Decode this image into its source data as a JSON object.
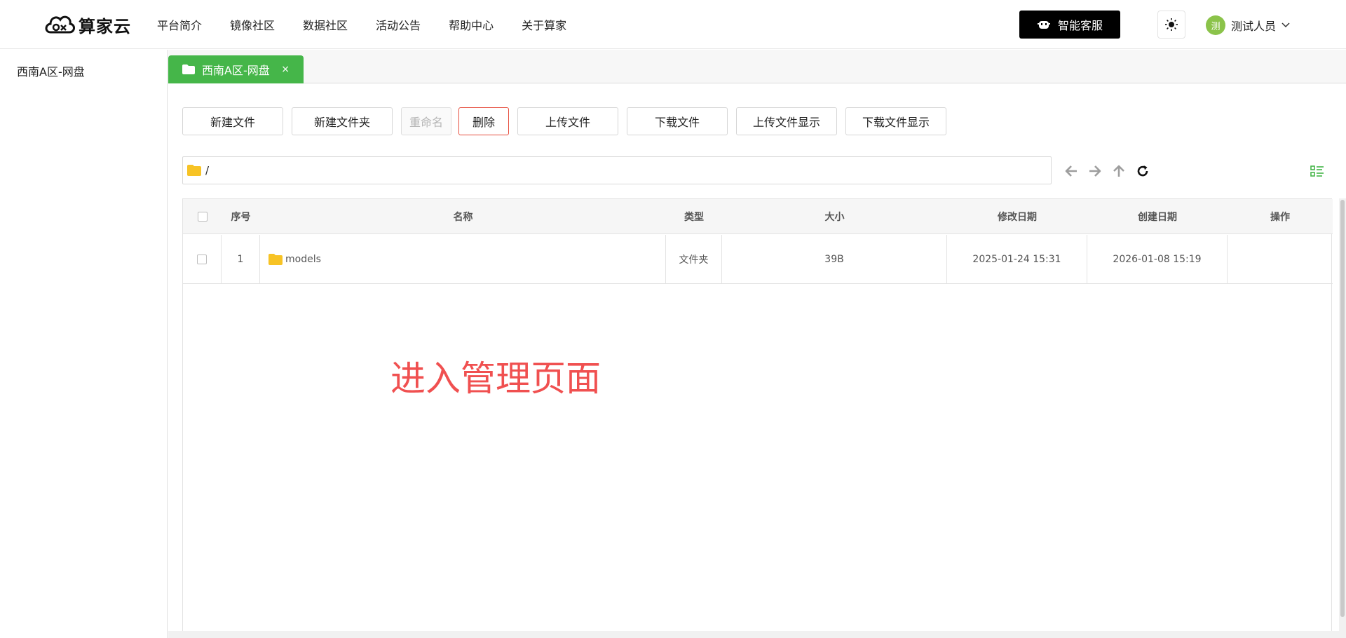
{
  "app": {
    "brand": "算家云"
  },
  "nav": {
    "items": [
      "平台简介",
      "镜像社区",
      "数据社区",
      "活动公告",
      "帮助中心",
      "关于算家"
    ]
  },
  "header": {
    "support_label": "智能客服",
    "user": {
      "avatar_text": "测",
      "name": "测试人员"
    }
  },
  "sidebar": {
    "items": [
      {
        "label": "西南A区-网盘"
      }
    ]
  },
  "tabs": [
    {
      "label": "西南A区-网盘",
      "close": "×"
    }
  ],
  "toolbar": {
    "new_file": "新建文件",
    "new_folder": "新建文件夹",
    "rename": "重命名",
    "delete": "删除",
    "upload": "上传文件",
    "download": "下载文件",
    "upload_show": "上传文件显示",
    "download_show": "下载文件显示"
  },
  "path": {
    "value": "/"
  },
  "table": {
    "headers": {
      "index": "序号",
      "name": "名称",
      "type": "类型",
      "size": "大小",
      "modified": "修改日期",
      "created": "创建日期",
      "actions": "操作"
    },
    "rows": [
      {
        "index": "1",
        "name": "models",
        "type": "文件夹",
        "size": "39B",
        "modified": "2025-01-24 15:31",
        "created": "2026-01-08 15:19",
        "actions": ""
      }
    ]
  },
  "annotation": {
    "text": "进入管理页面",
    "color": "#f05050"
  },
  "colors": {
    "accent": "#45b649",
    "danger": "#e64d3d",
    "folder": "#f7c325"
  }
}
